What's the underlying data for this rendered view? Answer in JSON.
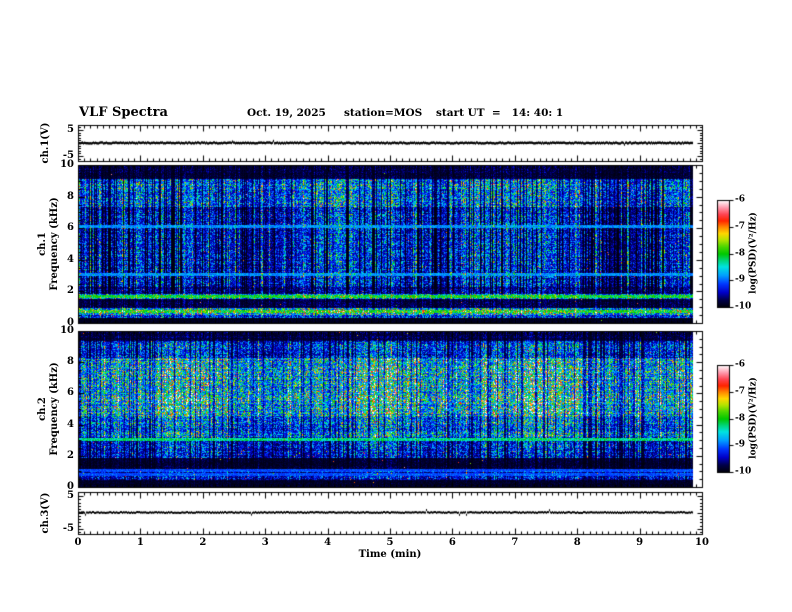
{
  "header": {
    "title": "VLF Spectra",
    "date": "Oct. 19, 2025",
    "station": "station=MOS",
    "start_ut": "start UT  =   14: 40: 1"
  },
  "chart_data": {
    "type": "heatmap",
    "title": "VLF Spectra",
    "description": "Four stacked panels sharing a common time axis: ch.1 voltage trace, ch.1 spectrogram, ch.2 spectrogram, ch.3 voltage trace",
    "x_axis": {
      "label": "Time (min)",
      "min": 0,
      "max": 10,
      "major_tick_step": 1,
      "minor_tick_step": 0.1,
      "tick_labels": [
        "0",
        "1",
        "2",
        "3",
        "4",
        "5",
        "6",
        "7",
        "8",
        "9",
        "10"
      ],
      "data_end": 9.85
    },
    "panels": [
      {
        "id": "ch1_voltage",
        "kind": "line",
        "ylabel": "ch.1(V)",
        "ymin": -5,
        "ymax": 5,
        "ytick_values": [
          5,
          -5
        ],
        "ytick_labels": [
          "5",
          "-5"
        ],
        "signal_mean_V": 0,
        "signal_shape": "flat line at 0 V with tiny blips",
        "render": {
          "seed": 31,
          "jitter": 1.1,
          "blip_prob": 0.012,
          "thickness": 2.4
        }
      },
      {
        "id": "ch1_spectrogram",
        "kind": "heatmap",
        "ylabel_channel": "ch.1",
        "ylabel_axis": "Frequency (kHz)",
        "ymin": 0,
        "ymax": 10,
        "ytick_values": [
          0,
          2,
          4,
          6,
          8,
          10
        ],
        "ytick_labels": [
          "0",
          "2",
          "4",
          "6",
          "8",
          "10"
        ],
        "minor_tick_step_kHz": 0.5,
        "colorbar": {
          "label": "log(PSD)(V²/Hz)",
          "min": -10,
          "max": -6,
          "tick_values": [
            -6,
            -7,
            -8,
            -9,
            -10
          ],
          "tick_labels": [
            "-6",
            "-7",
            "-8",
            "-9",
            "-10"
          ]
        },
        "render": {
          "seed": 12345,
          "bands": [
            [
              0,
              0.35,
              0.03,
              0.2,
              0.001
            ],
            [
              0.35,
              0.5,
              0.3,
              0.5,
              0.01
            ],
            [
              0.5,
              0.95,
              0.55,
              0.45,
              0.04
            ],
            [
              0.95,
              1.55,
              0.1,
              0.75,
              0.003
            ],
            [
              1.55,
              1.85,
              0.4,
              0.45,
              0.01
            ],
            [
              1.85,
              2.3,
              0.17,
              0.9,
              0.004
            ],
            [
              2.3,
              7.4,
              0.3,
              1.0,
              0.006
            ],
            [
              7.4,
              9.2,
              0.45,
              0.85,
              0.012
            ],
            [
              9.2,
              10,
              0.08,
              0.7,
              0.001
            ]
          ],
          "h_lines": [
            [
              0.75,
              0.5
            ],
            [
              1.7,
              0.5
            ],
            [
              3.1,
              0.3
            ],
            [
              6.15,
              0.3
            ]
          ],
          "dark_streak_prob": 0.2,
          "bright_streak_prob": 0.12,
          "hot_core_prob": 0.06
        }
      },
      {
        "id": "ch2_spectrogram",
        "kind": "heatmap",
        "ylabel_channel": "ch.2",
        "ylabel_axis": "Frequency (kHz)",
        "ymin": 0,
        "ymax": 10,
        "ytick_values": [
          0,
          2,
          4,
          6,
          8,
          10
        ],
        "ytick_labels": [
          "0",
          "2",
          "4",
          "6",
          "8",
          "10"
        ],
        "minor_tick_step_kHz": 0.5,
        "colorbar": {
          "label": "log(PSD)(V²/Hz)",
          "min": -10,
          "max": -6,
          "tick_values": [
            -6,
            -7,
            -8,
            -9,
            -10
          ],
          "tick_labels": [
            "-6",
            "-7",
            "-8",
            "-9",
            "-10"
          ]
        },
        "render": {
          "seed": 777,
          "bands": [
            [
              0,
              0.45,
              0.05,
              0.4,
              0.001
            ],
            [
              0.45,
              1.05,
              0.22,
              0.6,
              0.005
            ],
            [
              1.05,
              1.9,
              0.07,
              0.75,
              0.002
            ],
            [
              1.9,
              3.2,
              0.3,
              0.85,
              0.01
            ],
            [
              3.2,
              4.6,
              0.45,
              0.8,
              0.015
            ],
            [
              4.6,
              8.3,
              0.62,
              0.72,
              0.03
            ],
            [
              8.3,
              9.4,
              0.34,
              0.85,
              0.008
            ],
            [
              9.4,
              10,
              0.1,
              0.7,
              0.002
            ]
          ],
          "h_lines": [
            [
              0.8,
              0.24
            ],
            [
              1.05,
              0.24
            ],
            [
              3.05,
              0.45
            ]
          ],
          "dark_streak_prob": 0.16,
          "bright_streak_prob": 0.1,
          "hot_core_prob": 0.06
        }
      },
      {
        "id": "ch3_voltage",
        "kind": "line",
        "ylabel": "ch.3(V)",
        "ymin": -5,
        "ymax": 5,
        "ytick_values": [
          5,
          -5
        ],
        "ytick_labels": [
          "5",
          "-5"
        ],
        "signal_mean_V": 0,
        "signal_shape": "flat line at 0 V with tiny blips",
        "render": {
          "seed": 97,
          "jitter": 1.0,
          "blip_prob": 0.01,
          "thickness": 2.0
        }
      }
    ]
  },
  "colors": {
    "background": "#ffffff",
    "axis": "#000000",
    "colormap_stops": [
      [
        0.0,
        "#000008"
      ],
      [
        0.07,
        "#00004a"
      ],
      [
        0.14,
        "#0000c8"
      ],
      [
        0.22,
        "#0038ff"
      ],
      [
        0.3,
        "#00a0ff"
      ],
      [
        0.38,
        "#00e4e0"
      ],
      [
        0.44,
        "#00d678"
      ],
      [
        0.5,
        "#00c800"
      ],
      [
        0.57,
        "#50d800"
      ],
      [
        0.63,
        "#b4e400"
      ],
      [
        0.69,
        "#ffd800"
      ],
      [
        0.75,
        "#ff8800"
      ],
      [
        0.81,
        "#ff2400"
      ],
      [
        0.87,
        "#ff4452"
      ],
      [
        0.93,
        "#ff96aa"
      ],
      [
        1.0,
        "#ffffff"
      ]
    ]
  }
}
